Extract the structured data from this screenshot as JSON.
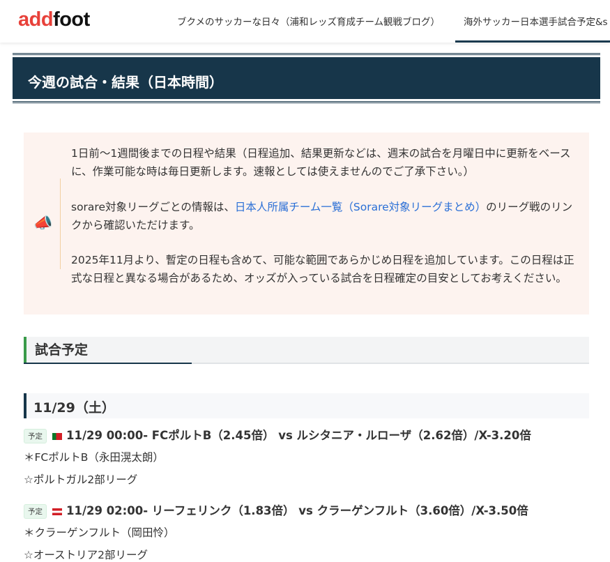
{
  "header": {
    "logo_a": "add",
    "logo_b": "foot",
    "nav": [
      "ブクメのサッカーな日々（浦和レッズ育成チーム観戦ブログ）",
      "海外サッカー日本選手試合予定&s"
    ]
  },
  "page_title": "今週の試合・結果（日本時間）",
  "info": {
    "icon": "megaphone-icon",
    "p1": "1日前〜1週間後までの日程や結果（日程追加、結果更新などは、週末の試合を月曜日中に更新をベースに、作業可能な時は毎日更新します。速報としては使えませんのでご了承下さい。）",
    "p2_pre": "sorare対象リーグごとの情報は、",
    "p2_link": "日本人所属チーム一覧（Sorare対象リーグまとめ）",
    "p2_post": "のリーグ戦のリンクから確認いただけます。",
    "p3": "2025年11月より、暫定の日程も含めて、可能な範囲であらかじめ日程を追加しています。この日程は正式な日程と異なる場合があるため、オッズが入っている試合を日程確定の目安としてお考えください。"
  },
  "section_title": "試合予定",
  "date_heading": "11/29（土）",
  "matches": [
    {
      "badge": "予定",
      "flag": "portugal",
      "title": "11/29 00:00- FCポルトB（2.45倍） vs ルシタニア・ルローザ（2.62倍）/X-3.20倍",
      "player": "＊FCポルトB（永田滉太朗）",
      "league": "☆ポルトガル2部リーグ"
    },
    {
      "badge": "予定",
      "flag": "austria",
      "title": "11/29 02:00- リーフェリンク（1.83倍） vs クラーゲンフルト（3.60倍）/X-3.50倍",
      "player": "＊クラーゲンフルト（岡田怜）",
      "league": "☆オーストリア2部リーグ"
    }
  ],
  "colors": {
    "navy": "#17364a",
    "accent_red": "#e8413a",
    "green": "#3a9b4a",
    "link": "#2a6fd6"
  }
}
